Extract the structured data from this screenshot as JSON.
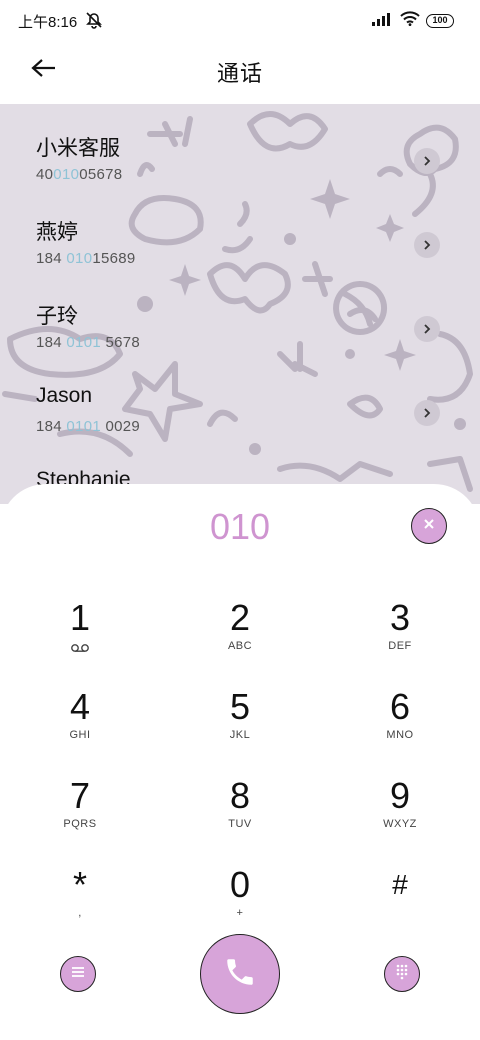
{
  "status_bar": {
    "time": "上午8:16",
    "battery": "100",
    "icons": [
      "bell-off-icon",
      "signal-icon",
      "wifi-icon",
      "battery-icon"
    ]
  },
  "header": {
    "title": "通话",
    "back_icon": "back-arrow-icon"
  },
  "contacts": [
    {
      "name": "小米客服",
      "number_pre": "40",
      "number_hl": "010",
      "number_post": "05678"
    },
    {
      "name": "燕婷",
      "number_pre": "184 ",
      "number_hl": "010",
      "number_post": "15689"
    },
    {
      "name": "子玲",
      "number_pre": "184 ",
      "number_hl": "0101",
      "number_post": " 5678"
    },
    {
      "name": "Jason",
      "number_pre": "184 ",
      "number_hl": "0101",
      "number_post": " 0029"
    },
    {
      "name": "Stephanie",
      "number_pre": "",
      "number_hl": "",
      "number_post": ""
    }
  ],
  "dialer": {
    "input": "010",
    "keys": [
      {
        "digit": "1",
        "letters": ""
      },
      {
        "digit": "2",
        "letters": "ABC"
      },
      {
        "digit": "3",
        "letters": "DEF"
      },
      {
        "digit": "4",
        "letters": "GHI"
      },
      {
        "digit": "5",
        "letters": "JKL"
      },
      {
        "digit": "6",
        "letters": "MNO"
      },
      {
        "digit": "7",
        "letters": "PQRS"
      },
      {
        "digit": "8",
        "letters": "TUV"
      },
      {
        "digit": "9",
        "letters": "WXYZ"
      },
      {
        "digit": "*",
        "letters": ","
      },
      {
        "digit": "0",
        "letters": "+"
      },
      {
        "digit": "#",
        "letters": ""
      }
    ]
  },
  "colors": {
    "accent": "#d7a4d9",
    "dialed_text": "#cf94d0",
    "number_highlight": "#8fc3d6",
    "contact_background": "#e2dde5"
  }
}
